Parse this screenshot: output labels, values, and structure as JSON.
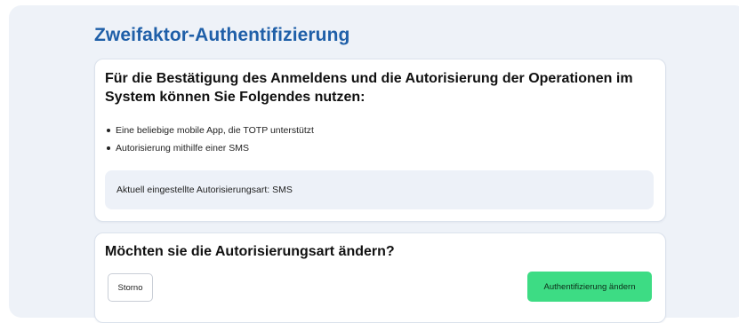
{
  "page": {
    "title": "Zweifaktor-Authentifizierung"
  },
  "info": {
    "heading": "Für die Bestätigung des Anmeldens und die Autorisierung der Operationen im System können Sie Folgendes nutzen:",
    "options": [
      "Eine beliebige mobile App, die TOTP unterstützt",
      "Autorisierung mithilfe einer SMS"
    ],
    "current": "Aktuell eingestellte Autorisierungsart: SMS"
  },
  "change": {
    "heading": "Möchten sie die Autorisierungsart ändern?",
    "cancel_label": "Storno",
    "confirm_label": "Authentifizierung ändern"
  },
  "colors": {
    "title": "#1f5fa8",
    "primary_button": "#3ddc84",
    "panel_background": "#eef2f8",
    "current_box": "#edf1f8"
  }
}
